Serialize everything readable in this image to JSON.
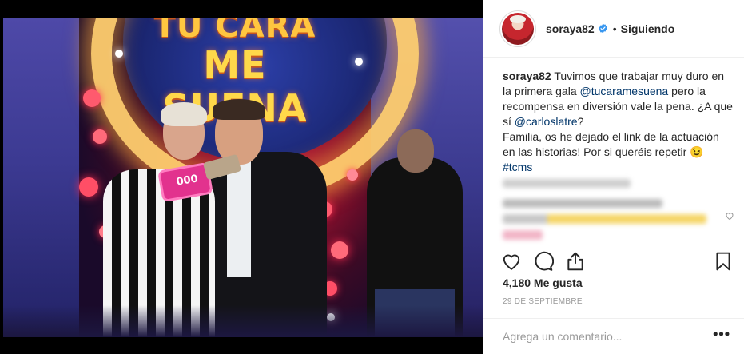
{
  "post": {
    "photo_logo_top": "TU CARA",
    "photo_logo_main": "ME SUENA",
    "photo_card_text": "000"
  },
  "header": {
    "username": "soraya82",
    "verified_icon": "verified-badge-icon",
    "separator": "•",
    "follow_status": "Siguiendo"
  },
  "caption": {
    "username": "soraya82",
    "text_1": " Tuvimos que trabajar muy duro en la primera gala ",
    "mention_1": "@tucaramesuena",
    "text_2": " pero la recompensa en diversión vale la pena. ¿A que sí ",
    "mention_2": "@carloslatre",
    "text_3": "?",
    "line_2": "Familia, os he dejado el link de la actuación en las historias! Por si queréis repetir 😉",
    "hashtag": "#tcms"
  },
  "actions": {
    "like_icon": "heart-icon",
    "comment_icon": "comment-icon",
    "share_icon": "share-icon",
    "save_icon": "bookmark-icon"
  },
  "likes": "4,180 Me gusta",
  "date": "29 DE SEPTIEMBRE",
  "comment": {
    "placeholder": "Agrega un comentario...",
    "more_label": "•••"
  },
  "colors": {
    "link": "#003569",
    "verified": "#3897f0",
    "border": "#efefef",
    "muted": "#999999"
  }
}
